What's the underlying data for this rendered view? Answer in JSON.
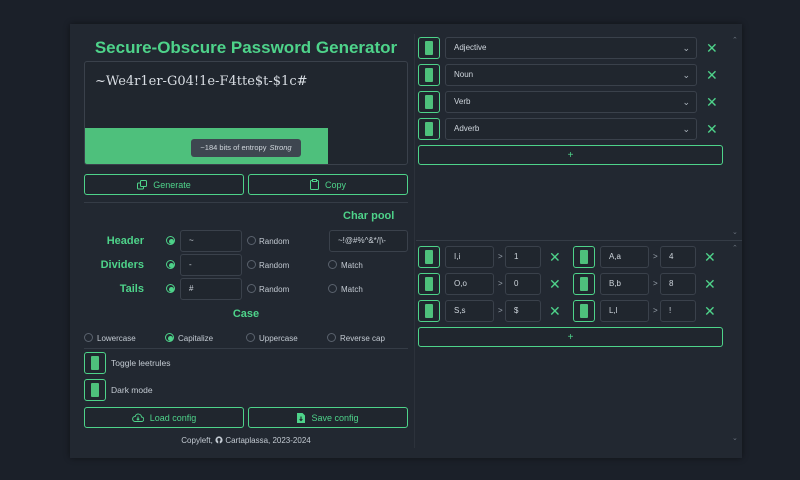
{
  "title": "Secure-Obscure Password Generator",
  "password": "~We4r1er-G04!1e-F4tte$t-$1c#",
  "entropy": {
    "text": "~184 bits of entropy",
    "rating": "Strong",
    "fill": 0.754
  },
  "buttons": {
    "generate": "Generate",
    "copy": "Copy",
    "load": "Load config",
    "save": "Save config"
  },
  "char_pool": {
    "heading": "Char pool",
    "value": "~!@#%^&*/|\\-"
  },
  "rows": [
    {
      "label": "Header",
      "value": "~",
      "random": "Random",
      "extra": ""
    },
    {
      "label": "Dividers",
      "value": "-",
      "random": "Random",
      "extra": "Match"
    },
    {
      "label": "Tails",
      "value": "#",
      "random": "Random",
      "extra": "Match"
    }
  ],
  "case": {
    "heading": "Case",
    "options": [
      "Lowercase",
      "Capitalize",
      "Uppercase",
      "Reverse cap"
    ],
    "selected": "Capitalize"
  },
  "toggles": {
    "leet": "Toggle leetrules",
    "dark": "Dark mode"
  },
  "footer": {
    "text": "Copyleft,",
    "author": "Cartaplassa, 2023-2024"
  },
  "word_types": [
    "Adjective",
    "Noun",
    "Verb",
    "Adverb"
  ],
  "add_label": "+",
  "gt": ">",
  "leet_rules": [
    {
      "from": "I,i",
      "to": "1"
    },
    {
      "from": "A,a",
      "to": "4"
    },
    {
      "from": "O,o",
      "to": "0"
    },
    {
      "from": "B,b",
      "to": "8"
    },
    {
      "from": "S,s",
      "to": "$"
    },
    {
      "from": "L,l",
      "to": "!"
    }
  ],
  "colors": {
    "accent": "#4ed38a",
    "panel": "#222831",
    "background": "#1b2029"
  }
}
